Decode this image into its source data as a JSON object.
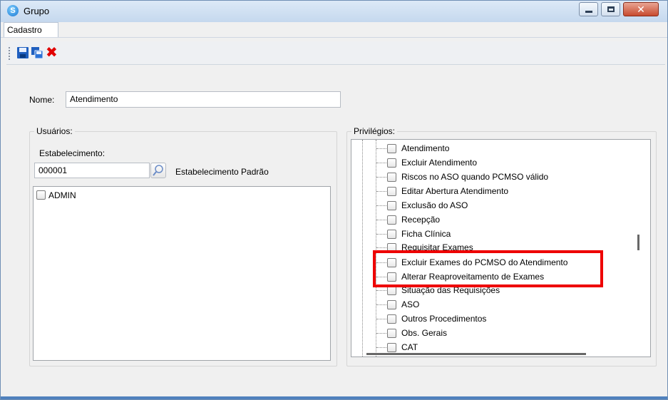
{
  "window": {
    "title": "Grupo",
    "close_glyph": "✕"
  },
  "tabs": [
    {
      "label": "Cadastro"
    }
  ],
  "toolbar": {
    "icons": [
      "save-icon",
      "save-all-icon",
      "cancel-icon"
    ],
    "cancel_glyph": "✖"
  },
  "form": {
    "nome_label": "Nome:",
    "nome_value": "Atendimento"
  },
  "usuarios": {
    "title": "Usuários:",
    "estabelecimento_label": "Estabelecimento:",
    "estabelecimento_code": "000001",
    "estabelecimento_name": "Estabelecimento Padrão",
    "users": [
      {
        "label": "ADMIN",
        "checked": false
      }
    ]
  },
  "privilegios": {
    "title": "Privilégios:",
    "items": [
      {
        "label": "Atendimento",
        "checked": false
      },
      {
        "label": "Excluir Atendimento",
        "checked": false
      },
      {
        "label": "Riscos no ASO quando PCMSO válido",
        "checked": false
      },
      {
        "label": "Editar Abertura Atendimento",
        "checked": false
      },
      {
        "label": "Exclusão do ASO",
        "checked": false
      },
      {
        "label": "Recepção",
        "checked": false
      },
      {
        "label": "Ficha Clínica",
        "checked": false
      },
      {
        "label": "Requisitar Exames",
        "checked": false
      },
      {
        "label": "Excluir Exames do PCMSO do Atendimento",
        "checked": false
      },
      {
        "label": "Alterar Reaproveitamento de Exames",
        "checked": false
      },
      {
        "label": "Situação das Requisições",
        "checked": false
      },
      {
        "label": "ASO",
        "checked": false
      },
      {
        "label": "Outros Procedimentos",
        "checked": false
      },
      {
        "label": "Obs. Gerais",
        "checked": false
      },
      {
        "label": "CAT",
        "checked": false
      }
    ]
  },
  "colors": {
    "highlight": "#ee0000",
    "accent": "#1976d2"
  }
}
